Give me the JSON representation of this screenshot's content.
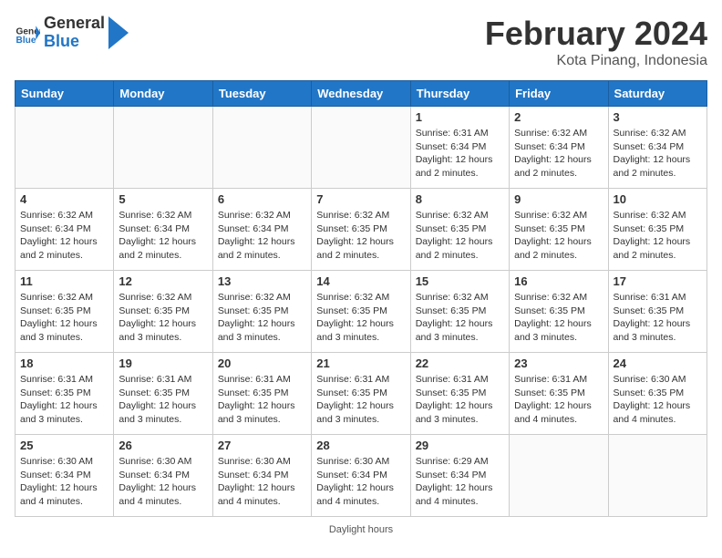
{
  "header": {
    "logo_general": "General",
    "logo_blue": "Blue",
    "title": "February 2024",
    "subtitle": "Kota Pinang, Indonesia"
  },
  "calendar": {
    "days_of_week": [
      "Sunday",
      "Monday",
      "Tuesday",
      "Wednesday",
      "Thursday",
      "Friday",
      "Saturday"
    ],
    "weeks": [
      [
        {
          "day": "",
          "info": ""
        },
        {
          "day": "",
          "info": ""
        },
        {
          "day": "",
          "info": ""
        },
        {
          "day": "",
          "info": ""
        },
        {
          "day": "1",
          "info": "Sunrise: 6:31 AM\nSunset: 6:34 PM\nDaylight: 12 hours and 2 minutes."
        },
        {
          "day": "2",
          "info": "Sunrise: 6:32 AM\nSunset: 6:34 PM\nDaylight: 12 hours and 2 minutes."
        },
        {
          "day": "3",
          "info": "Sunrise: 6:32 AM\nSunset: 6:34 PM\nDaylight: 12 hours and 2 minutes."
        }
      ],
      [
        {
          "day": "4",
          "info": "Sunrise: 6:32 AM\nSunset: 6:34 PM\nDaylight: 12 hours and 2 minutes."
        },
        {
          "day": "5",
          "info": "Sunrise: 6:32 AM\nSunset: 6:34 PM\nDaylight: 12 hours and 2 minutes."
        },
        {
          "day": "6",
          "info": "Sunrise: 6:32 AM\nSunset: 6:34 PM\nDaylight: 12 hours and 2 minutes."
        },
        {
          "day": "7",
          "info": "Sunrise: 6:32 AM\nSunset: 6:35 PM\nDaylight: 12 hours and 2 minutes."
        },
        {
          "day": "8",
          "info": "Sunrise: 6:32 AM\nSunset: 6:35 PM\nDaylight: 12 hours and 2 minutes."
        },
        {
          "day": "9",
          "info": "Sunrise: 6:32 AM\nSunset: 6:35 PM\nDaylight: 12 hours and 2 minutes."
        },
        {
          "day": "10",
          "info": "Sunrise: 6:32 AM\nSunset: 6:35 PM\nDaylight: 12 hours and 2 minutes."
        }
      ],
      [
        {
          "day": "11",
          "info": "Sunrise: 6:32 AM\nSunset: 6:35 PM\nDaylight: 12 hours and 3 minutes."
        },
        {
          "day": "12",
          "info": "Sunrise: 6:32 AM\nSunset: 6:35 PM\nDaylight: 12 hours and 3 minutes."
        },
        {
          "day": "13",
          "info": "Sunrise: 6:32 AM\nSunset: 6:35 PM\nDaylight: 12 hours and 3 minutes."
        },
        {
          "day": "14",
          "info": "Sunrise: 6:32 AM\nSunset: 6:35 PM\nDaylight: 12 hours and 3 minutes."
        },
        {
          "day": "15",
          "info": "Sunrise: 6:32 AM\nSunset: 6:35 PM\nDaylight: 12 hours and 3 minutes."
        },
        {
          "day": "16",
          "info": "Sunrise: 6:32 AM\nSunset: 6:35 PM\nDaylight: 12 hours and 3 minutes."
        },
        {
          "day": "17",
          "info": "Sunrise: 6:31 AM\nSunset: 6:35 PM\nDaylight: 12 hours and 3 minutes."
        }
      ],
      [
        {
          "day": "18",
          "info": "Sunrise: 6:31 AM\nSunset: 6:35 PM\nDaylight: 12 hours and 3 minutes."
        },
        {
          "day": "19",
          "info": "Sunrise: 6:31 AM\nSunset: 6:35 PM\nDaylight: 12 hours and 3 minutes."
        },
        {
          "day": "20",
          "info": "Sunrise: 6:31 AM\nSunset: 6:35 PM\nDaylight: 12 hours and 3 minutes."
        },
        {
          "day": "21",
          "info": "Sunrise: 6:31 AM\nSunset: 6:35 PM\nDaylight: 12 hours and 3 minutes."
        },
        {
          "day": "22",
          "info": "Sunrise: 6:31 AM\nSunset: 6:35 PM\nDaylight: 12 hours and 3 minutes."
        },
        {
          "day": "23",
          "info": "Sunrise: 6:31 AM\nSunset: 6:35 PM\nDaylight: 12 hours and 4 minutes."
        },
        {
          "day": "24",
          "info": "Sunrise: 6:30 AM\nSunset: 6:35 PM\nDaylight: 12 hours and 4 minutes."
        }
      ],
      [
        {
          "day": "25",
          "info": "Sunrise: 6:30 AM\nSunset: 6:34 PM\nDaylight: 12 hours and 4 minutes."
        },
        {
          "day": "26",
          "info": "Sunrise: 6:30 AM\nSunset: 6:34 PM\nDaylight: 12 hours and 4 minutes."
        },
        {
          "day": "27",
          "info": "Sunrise: 6:30 AM\nSunset: 6:34 PM\nDaylight: 12 hours and 4 minutes."
        },
        {
          "day": "28",
          "info": "Sunrise: 6:30 AM\nSunset: 6:34 PM\nDaylight: 12 hours and 4 minutes."
        },
        {
          "day": "29",
          "info": "Sunrise: 6:29 AM\nSunset: 6:34 PM\nDaylight: 12 hours and 4 minutes."
        },
        {
          "day": "",
          "info": ""
        },
        {
          "day": "",
          "info": ""
        }
      ]
    ]
  },
  "footer": {
    "text": "Daylight hours"
  }
}
